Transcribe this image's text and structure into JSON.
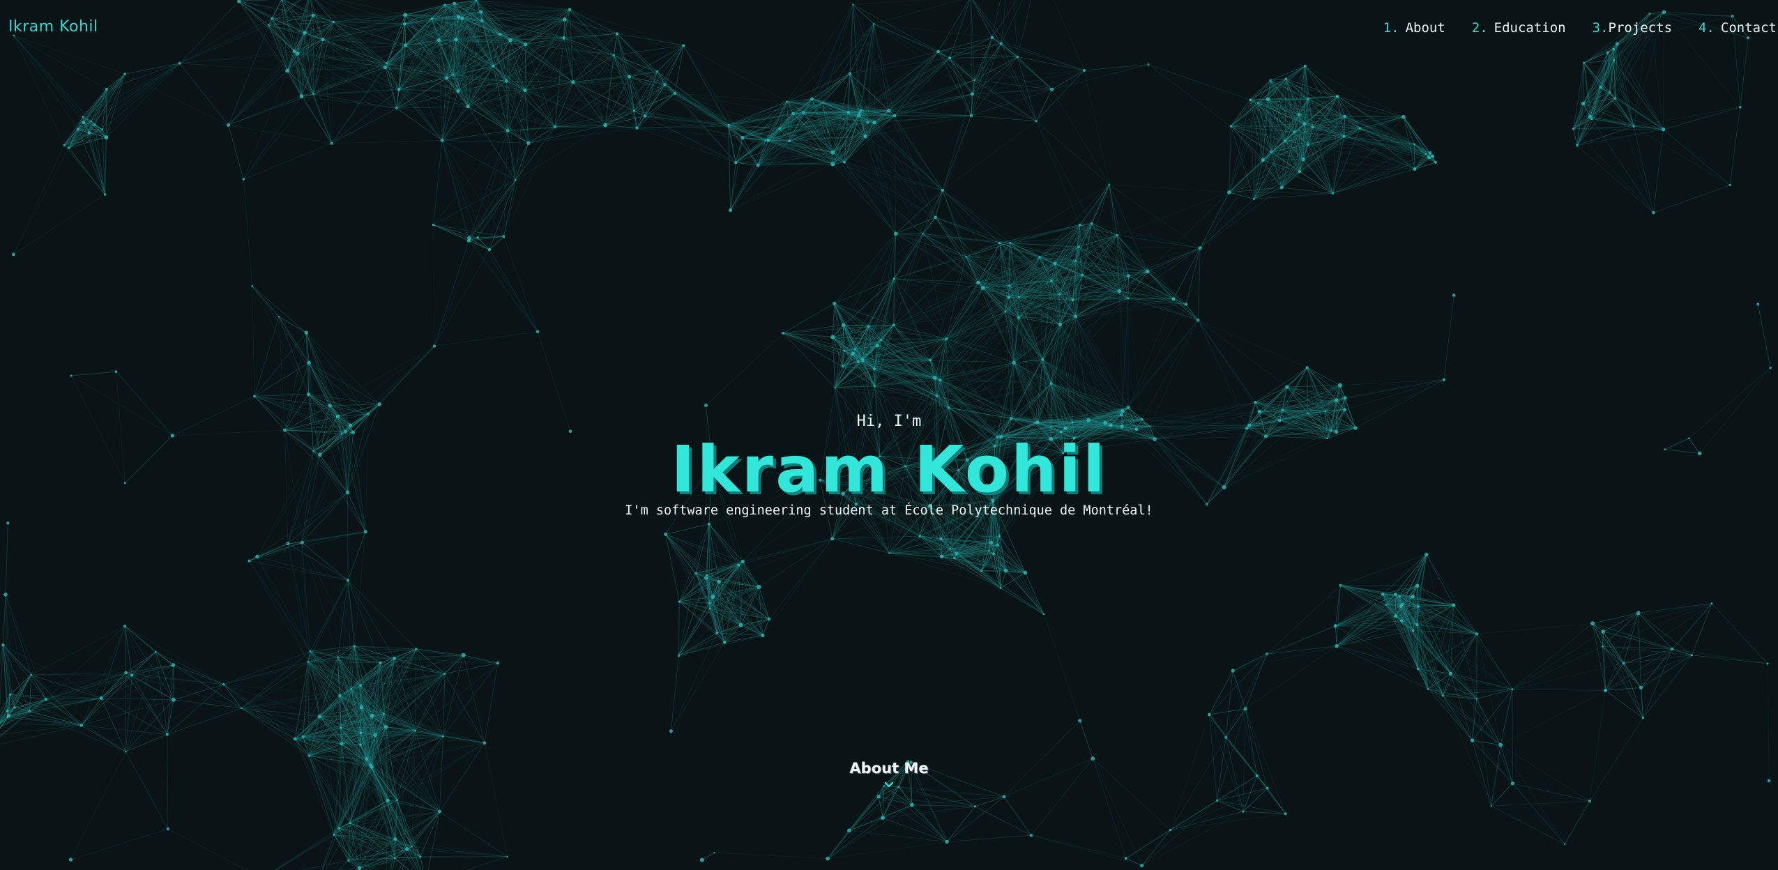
{
  "header": {
    "logo": "Ikram Kohil",
    "nav": [
      {
        "num": "1.",
        "label": "About"
      },
      {
        "num": "2.",
        "label": "Education"
      },
      {
        "num": "3.",
        "label": "Projects"
      },
      {
        "num": "4.",
        "label": "Contact"
      }
    ]
  },
  "hero": {
    "greeting": "Hi, I'm",
    "name": "Ikram Kohil",
    "tagline": "I'm software engineering student at École Polytechnique de Montréal!"
  },
  "scroll": {
    "label": "About Me",
    "icon": "chevron-down-icon"
  },
  "colors": {
    "accent": "#33e6da",
    "background": "#0a1416",
    "text": "#f0f7f7"
  }
}
